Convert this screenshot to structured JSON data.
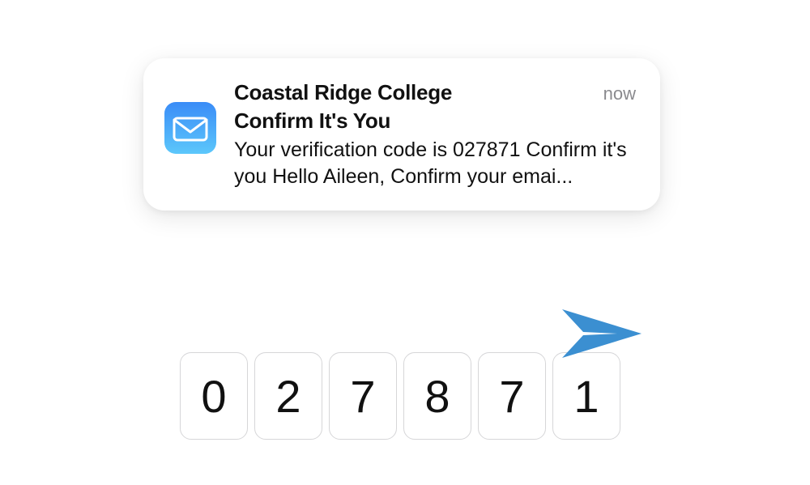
{
  "notification": {
    "sender": "Coastal Ridge College",
    "subject": "Confirm It's You",
    "body": "Your verification code is 027871 Confirm it's you Hello Aileen, Confirm your emai...",
    "time": "now"
  },
  "code": {
    "digits": [
      "0",
      "2",
      "7",
      "8",
      "7",
      "1"
    ]
  },
  "icons": {
    "mail": "mail-icon",
    "send": "paper-plane-icon"
  }
}
